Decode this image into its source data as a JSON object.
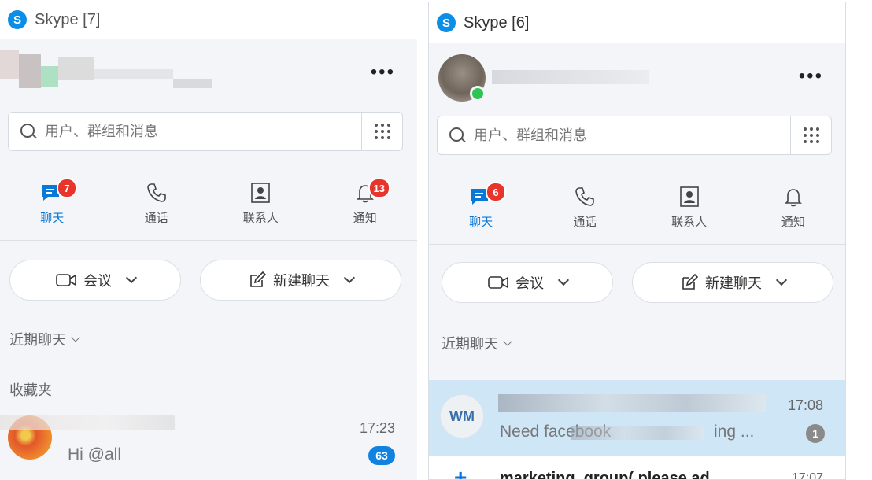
{
  "left_window": {
    "title": "Skype [7]",
    "search_placeholder": "用户、群组和消息",
    "tabs": [
      {
        "label": "聊天",
        "badge": "7",
        "icon": "chat-icon"
      },
      {
        "label": "通话",
        "badge": "",
        "icon": "phone-icon"
      },
      {
        "label": "联系人",
        "badge": "",
        "icon": "contacts-icon"
      },
      {
        "label": "通知",
        "badge": "13",
        "icon": "bell-icon"
      }
    ],
    "meeting_label": "会议",
    "new_chat_label": "新建聊天",
    "recent_label": "近期聊天",
    "favorites_label": "收藏夹",
    "chat": {
      "time": "17:23",
      "preview": "Hi @all",
      "unread": "63"
    }
  },
  "right_window": {
    "title": "Skype [6]",
    "search_placeholder": "用户、群组和消息",
    "tabs": [
      {
        "label": "聊天",
        "badge": "6",
        "icon": "chat-icon"
      },
      {
        "label": "通话",
        "badge": "",
        "icon": "phone-icon"
      },
      {
        "label": "联系人",
        "badge": "",
        "icon": "contacts-icon"
      },
      {
        "label": "通知",
        "badge": "",
        "icon": "bell-icon"
      }
    ],
    "meeting_label": "会议",
    "new_chat_label": "新建聊天",
    "recent_label": "近期聊天",
    "chats": [
      {
        "initials": "WM",
        "time": "17:08",
        "preview": "Need facebook",
        "preview_end": "ing ...",
        "unread": "1"
      },
      {
        "name": "marketing_group( please ad",
        "time": "17:07"
      }
    ]
  },
  "colors": {
    "accent": "#0a78d6",
    "badge_red": "#e8352b",
    "selected_row": "#cfe6f6",
    "online": "#2dc453"
  }
}
